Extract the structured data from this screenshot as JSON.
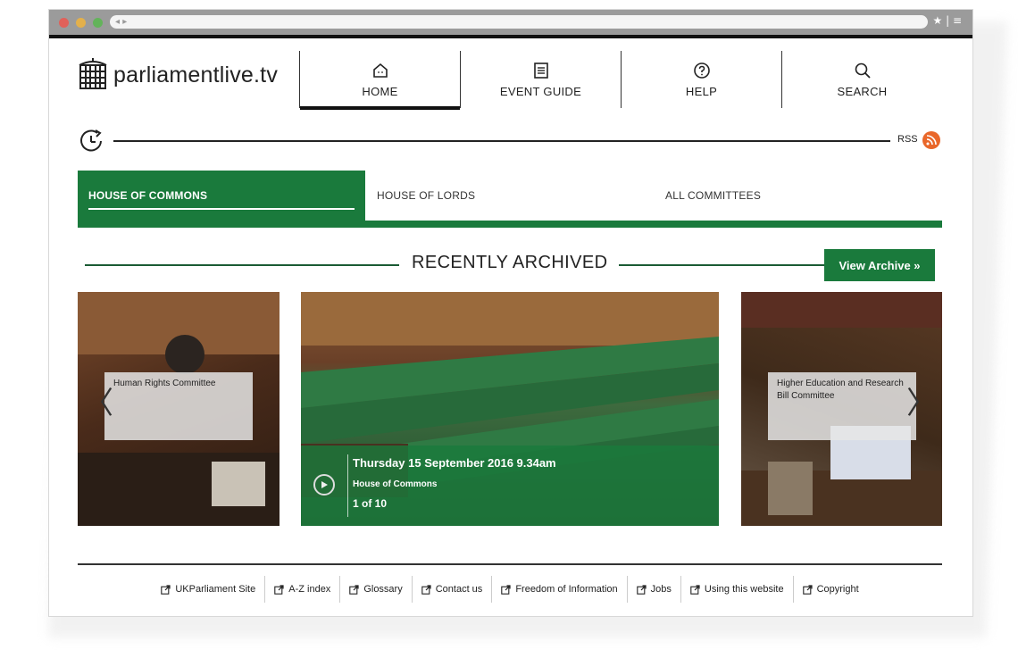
{
  "browser": {
    "nav_arrows": "◂ ▸",
    "tools": "★ | ≡"
  },
  "site": {
    "logo_text": "parliamentlive.tv"
  },
  "nav": [
    {
      "label": "HOME",
      "icon": "home-icon",
      "active": true
    },
    {
      "label": "EVENT GUIDE",
      "icon": "list-icon",
      "active": false
    },
    {
      "label": "HELP",
      "icon": "help-icon",
      "active": false
    },
    {
      "label": "SEARCH",
      "icon": "search-icon",
      "active": false
    }
  ],
  "timeline": {
    "rss_label": "RSS"
  },
  "tabs": [
    {
      "label": "HOUSE OF COMMONS",
      "active": true
    },
    {
      "label": "HOUSE OF LORDS",
      "active": false
    },
    {
      "label": "ALL COMMITTEES",
      "active": false
    }
  ],
  "archive": {
    "heading": "RECENTLY ARCHIVED",
    "view_button": "View Archive »"
  },
  "carousel": {
    "left_label": "Human Rights Committee",
    "right_label": "Higher Education and Research Bill Committee",
    "center": {
      "date": "Thursday 15 September 2016 9.34am",
      "house": "House of Commons",
      "count": "1 of 10"
    },
    "prev_glyph": "〈",
    "next_glyph": "〉"
  },
  "footer": {
    "links": [
      "UKParliament Site",
      "A-Z index",
      "Glossary",
      "Contact us",
      "Freedom of Information",
      "Jobs",
      "Using this website",
      "Copyright"
    ]
  },
  "colors": {
    "brand_green": "#1a7a3c",
    "rss_orange": "#e9672a"
  }
}
